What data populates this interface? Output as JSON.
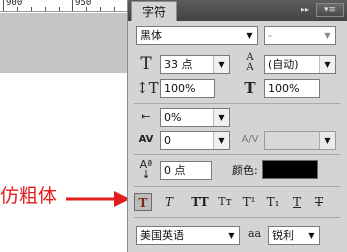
{
  "ruler": {
    "labels": [
      "900",
      "950"
    ]
  },
  "annotation": {
    "text": "仿粗体",
    "color": "#e21d1d"
  },
  "panel": {
    "tab_label": "字符",
    "collapse_icon": "▸▸",
    "menu_icon": "▾≡"
  },
  "font": {
    "family": "黑体",
    "style": "-"
  },
  "size": {
    "value": "33 点"
  },
  "leading": {
    "value": "(自动)"
  },
  "vscale": {
    "value": "100%"
  },
  "hscale": {
    "value": "100%"
  },
  "tsume": {
    "value": "0%"
  },
  "kerning": {
    "value": "0"
  },
  "tracking": {
    "value": ""
  },
  "baseline": {
    "value": "0 点"
  },
  "color": {
    "label": "颜色:",
    "swatch": "#000000"
  },
  "styles": [
    {
      "glyph": "T",
      "name": "faux-bold"
    },
    {
      "glyph": "T",
      "name": "faux-italic"
    },
    {
      "glyph": "TT",
      "name": "all-caps"
    },
    {
      "glyph": "Tт",
      "name": "small-caps"
    },
    {
      "glyph": "T¹",
      "name": "superscript"
    },
    {
      "glyph": "T₁",
      "name": "subscript"
    },
    {
      "glyph": "T",
      "name": "underline"
    },
    {
      "glyph": "T",
      "name": "strikethrough"
    }
  ],
  "language": {
    "value": "美国英语"
  },
  "antialias": {
    "icon": "aa",
    "value": "锐利"
  }
}
